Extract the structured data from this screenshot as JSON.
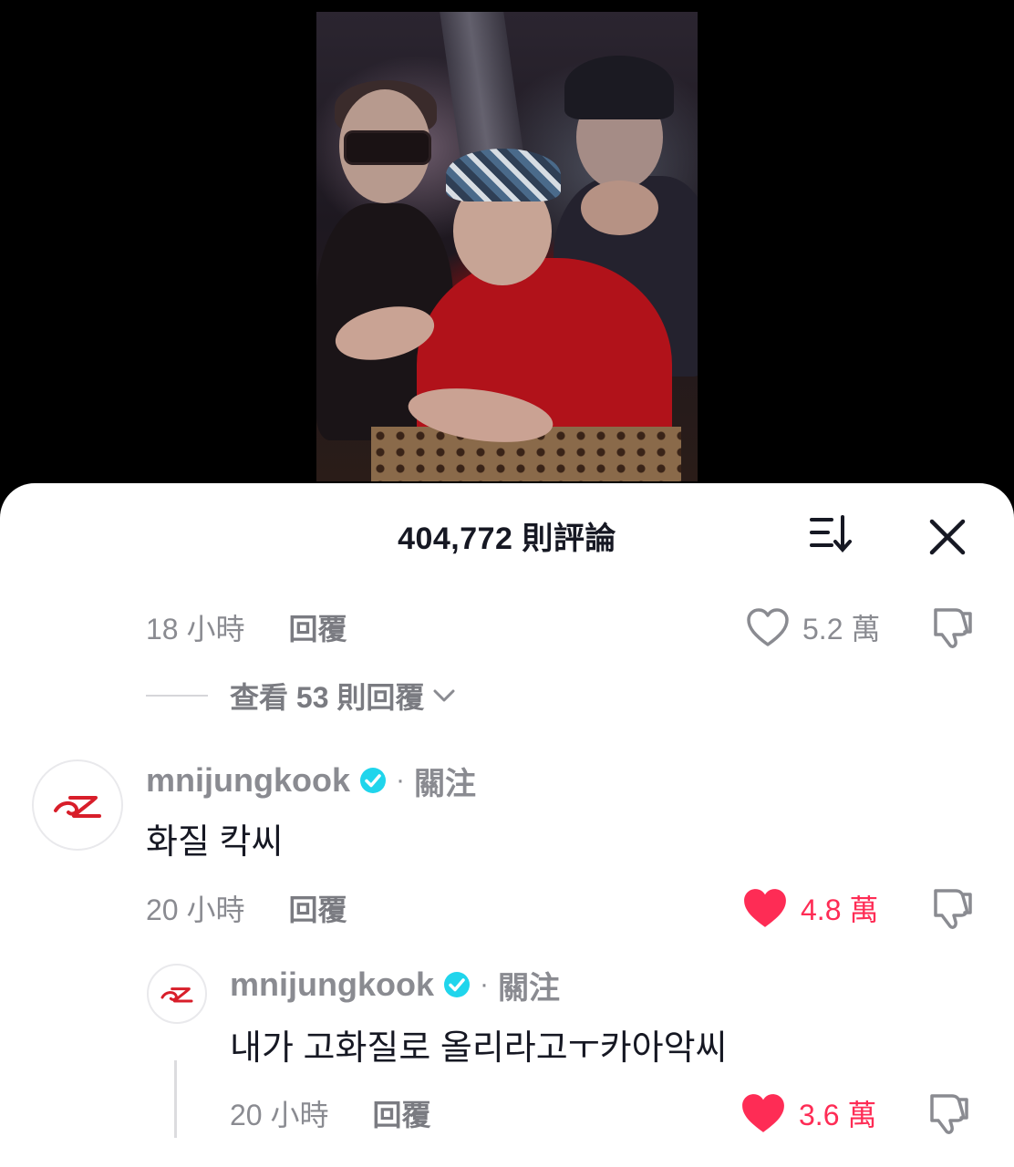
{
  "header": {
    "title": "404,772 則評論"
  },
  "icons": {
    "sort": "sort-icon",
    "close": "close-icon",
    "heart": "heart-icon",
    "dislike": "dislike-icon",
    "verified": "verified-badge-icon",
    "chevron": "chevron-down-icon"
  },
  "colors": {
    "liked": "#fe2c55",
    "verified": "#20d5ec",
    "muted": "#8a8b91",
    "text": "#161823"
  },
  "comment_above": {
    "time": "18 小時",
    "reply_label": "回覆",
    "likes": "5.2 萬",
    "liked": false,
    "view_replies": "查看 53 則回覆"
  },
  "comment_main": {
    "username": "mnijungkook",
    "dot": "·",
    "follow": "關注",
    "text": "화질 칵씨",
    "time": "20 小時",
    "reply_label": "回覆",
    "likes": "4.8 萬",
    "liked": true
  },
  "reply": {
    "username": "mnijungkook",
    "dot": "·",
    "follow": "關注",
    "text": "내가 고화질로 올리라고ㅜ카아악씨",
    "time": "20 小時",
    "reply_label": "回覆",
    "likes": "3.6 萬",
    "liked": true
  }
}
